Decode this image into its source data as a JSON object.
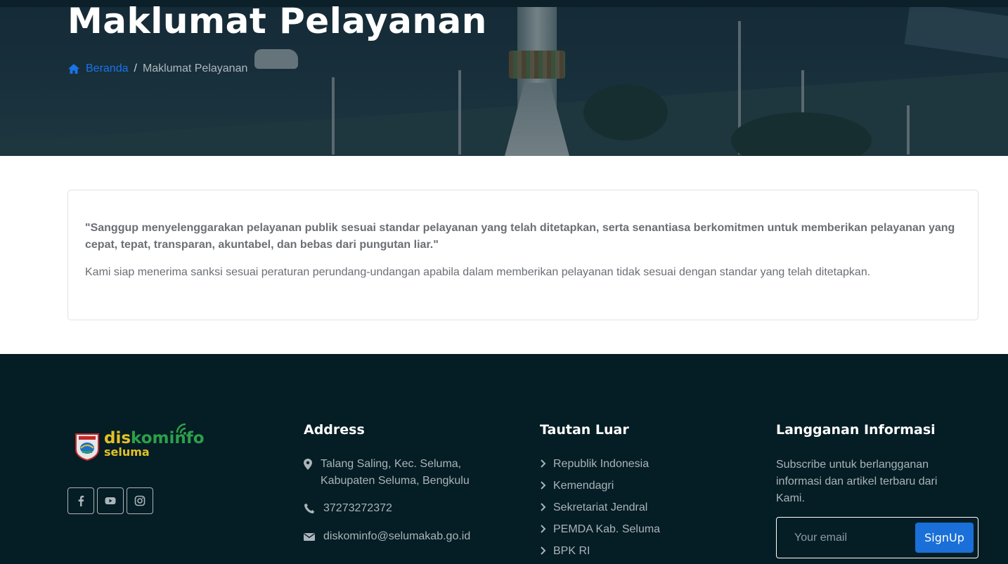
{
  "hero": {
    "title": "Maklumat Pelayanan",
    "breadcrumb": {
      "home_label": "Beranda",
      "separator": "/",
      "current": "Maklumat Pelayanan"
    }
  },
  "content": {
    "quote": "\"Sanggup menyelenggarakan pelayanan publik sesuai standar pelayanan yang telah ditetapkan, serta senantiasa berkomitmen untuk memberikan pelayanan yang cepat, tepat, transparan, akuntabel, dan bebas dari pungutan liar.\"",
    "note": "Kami siap menerima sanksi sesuai peraturan perundang-undangan apabila dalam memberikan pelayanan tidak sesuai dengan standar yang telah ditetapkan."
  },
  "footer": {
    "logo": {
      "word_a": "dis",
      "word_b": "kominfo",
      "word_c": "seluma"
    },
    "socials": [
      "facebook-icon",
      "youtube-icon",
      "instagram-icon"
    ],
    "address": {
      "title": "Address",
      "location": "Talang Saling, Kec. Seluma, Kabupaten Seluma, Bengkulu",
      "phone": "37273272372",
      "email": "diskominfo@selumakab.go.id"
    },
    "links": {
      "title": "Tautan Luar",
      "items": [
        "Republik Indonesia",
        "Kemendagri",
        "Sekretariat Jendral",
        "PEMDA Kab. Seluma",
        "BPK RI"
      ]
    },
    "newsletter": {
      "title": "Langganan Informasi",
      "text": "Subscribe untuk berlangganan informasi dan artikel terbaru dari Kami.",
      "placeholder": "Your email",
      "button": "SignUp"
    }
  },
  "colors": {
    "accent": "#1a6fd8",
    "footer_bg": "#051d24",
    "logo_yellow": "#e3c226",
    "logo_green": "#2ca04a"
  }
}
